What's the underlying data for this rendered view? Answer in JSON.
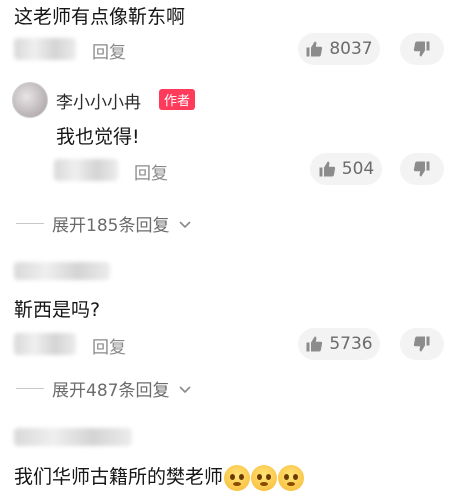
{
  "comments": [
    {
      "text": "这老师有点像靳东啊",
      "reply_label": "回复",
      "likes": "8037"
    },
    {
      "author": "李小小小冉",
      "author_badge": "作者",
      "text": "我也觉得!",
      "reply_label": "回复",
      "likes": "504"
    },
    {
      "expand_label": "展开185条回复"
    },
    {
      "text": "靳西是吗?",
      "reply_label": "回复",
      "likes": "5736"
    },
    {
      "expand_label": "展开487条回复"
    },
    {
      "text": "我们华师古籍所的樊老师"
    }
  ],
  "icons": {
    "like": "thumbs-up-icon",
    "dislike": "thumbs-down-icon",
    "expand": "chevron-down-icon",
    "emoji": "pleading-face-emoji"
  },
  "colors": {
    "author_badge": "#ff3b5c",
    "secondary_text": "#8a8a8a"
  }
}
